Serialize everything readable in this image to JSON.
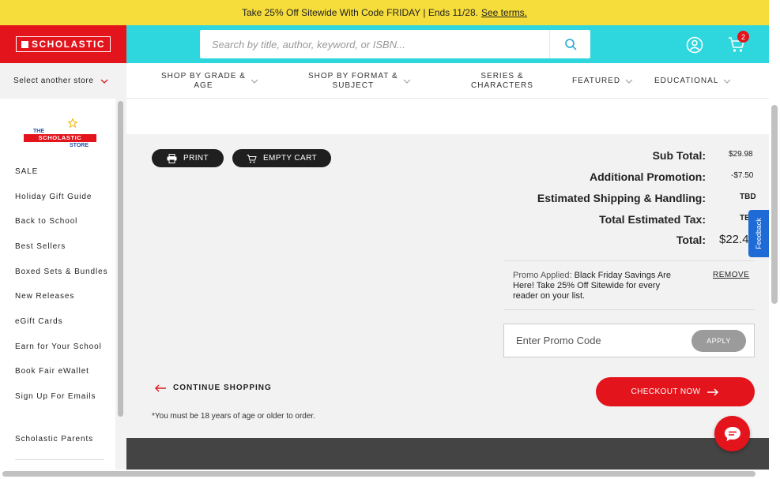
{
  "promo_bar": {
    "text": "Take 25% Off Sitewide With Code FRIDAY | Ends 11/28.",
    "link": "See terms."
  },
  "header": {
    "logo_text": "SCHOLASTIC",
    "search_placeholder": "Search by title, author, keyword, or ISBN...",
    "cart_count": "2"
  },
  "store_select": {
    "label": "Select another store"
  },
  "nav": {
    "items": [
      {
        "line1": "SHOP BY GRADE &",
        "line2": "AGE"
      },
      {
        "line1": "SHOP BY FORMAT &",
        "line2": "SUBJECT"
      },
      {
        "line1": "SERIES &",
        "line2": "CHARACTERS"
      },
      {
        "line1": "FEATURED",
        "line2": ""
      },
      {
        "line1": "EDUCATIONAL",
        "line2": ""
      }
    ]
  },
  "sidebar": {
    "logo_the": "THE",
    "logo_main": "SCHOLASTIC",
    "logo_store": "STORE",
    "items": [
      "SALE",
      "Holiday Gift Guide",
      "Back to School",
      "Best Sellers",
      "Boxed Sets & Bundles",
      "New Releases",
      "eGift Cards",
      "Earn for Your School",
      "Book Fair eWallet",
      "Sign Up For Emails",
      "Scholastic Parents"
    ]
  },
  "actions": {
    "print": "PRINT",
    "empty_cart": "EMPTY CART"
  },
  "summary": {
    "subtotal_label": "Sub Total:",
    "subtotal_value": "$29.98",
    "promo_label": "Additional Promotion:",
    "promo_value": "-$7.50",
    "shipping_label": "Estimated Shipping & Handling:",
    "shipping_value": "TBD",
    "tax_label": "Total Estimated Tax:",
    "tax_value": "TB",
    "total_label": "Total:",
    "total_value": "$22.4"
  },
  "promo_applied": {
    "label": "Promo Applied:",
    "text": "Black Friday Savings Are Here! Take 25% Off Sitewide for every reader on your list.",
    "remove": "REMOVE"
  },
  "promo_code": {
    "placeholder": "Enter Promo Code",
    "apply": "APPLY"
  },
  "continue_label": "CONTINUE SHOPPING",
  "checkout_label": "CHECKOUT NOW",
  "age_note": "*You must be 18 years of age or older to order.",
  "feedback_label": "Feedback",
  "colors": {
    "promo_yellow": "#f6dd3b",
    "brand_red": "#e3141c",
    "header_cyan": "#2ed6de",
    "feedback_blue": "#1e6bd6"
  }
}
